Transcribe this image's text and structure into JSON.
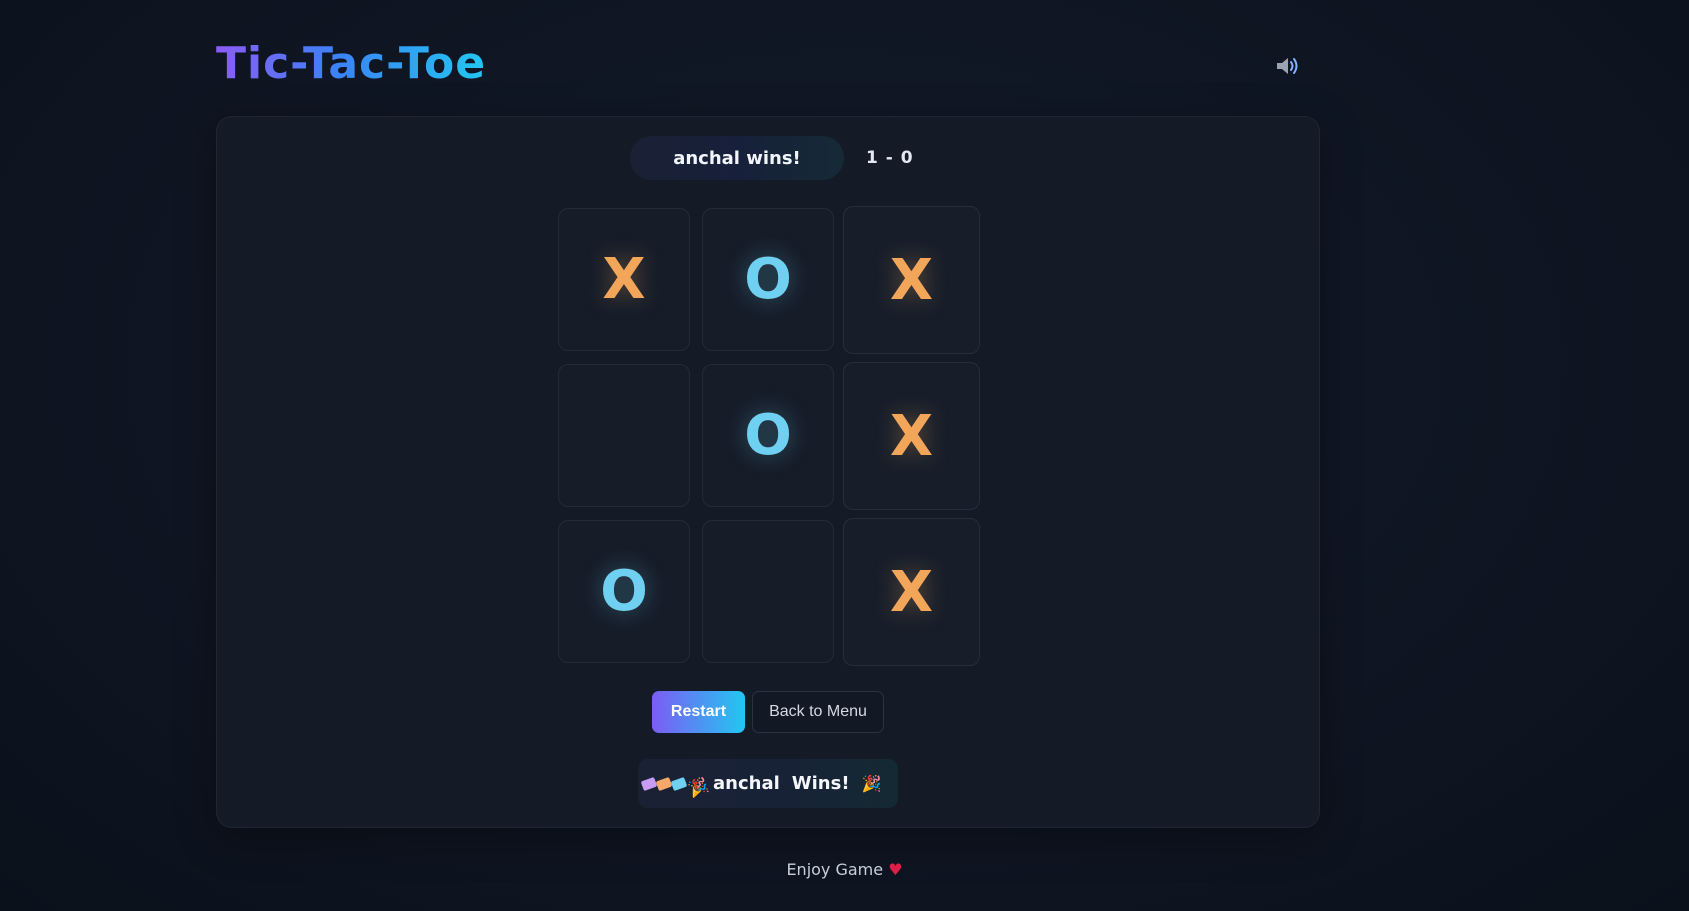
{
  "header": {
    "title": "Tic-Tac-Toe",
    "sound_icon": "speaker-volume-icon"
  },
  "status": {
    "message": "anchal wins!",
    "score": "1 - 0"
  },
  "board": {
    "cells": [
      "X",
      "O",
      "X",
      "",
      "O",
      "X",
      "O",
      "",
      "X"
    ],
    "winning_cells": [
      2,
      5,
      8
    ]
  },
  "colors": {
    "x_mark": "#f2a65a",
    "o_mark": "#6fd0f2",
    "accent_start": "#7c5cf5",
    "accent_end": "#22c7f0"
  },
  "controls": {
    "restart_label": "Restart",
    "menu_label": "Back to Menu"
  },
  "banner": {
    "player": "anchal",
    "result": "Wins!",
    "icons": [
      "confetti-icon",
      "party-popper-icon"
    ]
  },
  "footer": {
    "text": "Enjoy Game",
    "icon": "heart-icon"
  }
}
